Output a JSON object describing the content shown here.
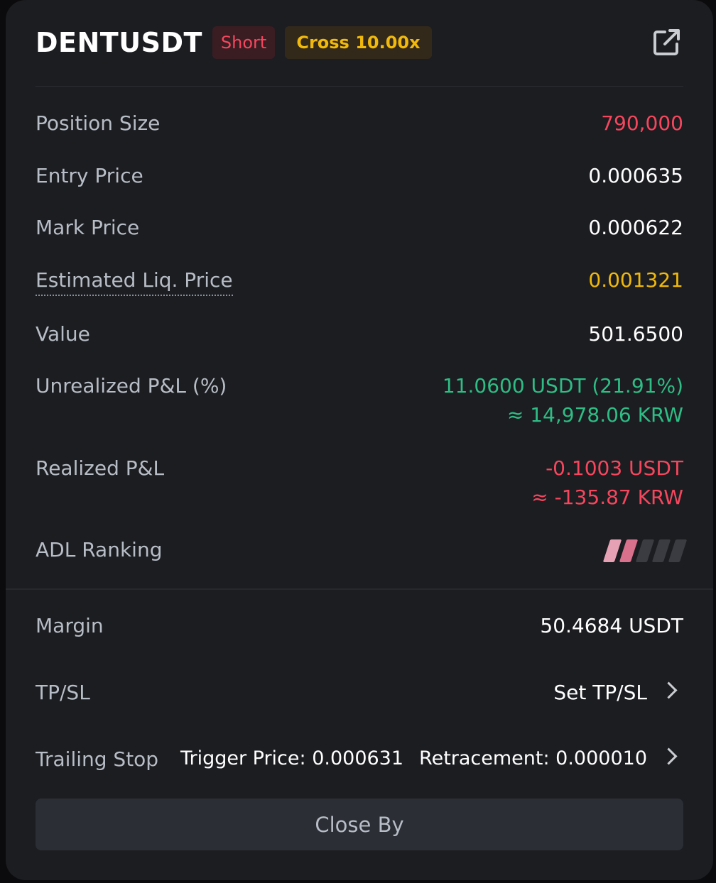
{
  "header": {
    "symbol": "DENTUSDT",
    "side_badge": "Short",
    "margin_badge": "Cross 10.00x",
    "share_icon": "external-link-icon"
  },
  "rows": {
    "position_size": {
      "label": "Position Size",
      "value": "790,000"
    },
    "entry_price": {
      "label": "Entry Price",
      "value": "0.000635"
    },
    "mark_price": {
      "label": "Mark Price",
      "value": "0.000622"
    },
    "liq_price": {
      "label": "Estimated Liq. Price",
      "value": "0.001321"
    },
    "value": {
      "label": "Value",
      "value": "501.6500"
    },
    "unrealized_pnl": {
      "label": "Unrealized P&L (%)",
      "value": "11.0600 USDT (21.91%)",
      "value_krw": "≈ 14,978.06 KRW"
    },
    "realized_pnl": {
      "label": "Realized P&L",
      "value": "-0.1003 USDT",
      "value_krw": "≈ -135.87 KRW"
    },
    "adl_ranking": {
      "label": "ADL Ranking",
      "level": 2,
      "max": 5
    },
    "margin": {
      "label": "Margin",
      "value": "50.4684 USDT"
    },
    "tpsl": {
      "label": "TP/SL",
      "value": "Set TP/SL"
    },
    "trailing_stop": {
      "label": "Trailing Stop",
      "trigger": "Trigger Price: 0.000631",
      "retracement": "Retracement: 0.000010"
    }
  },
  "actions": {
    "close_by": "Close By"
  },
  "colors": {
    "background": "#1c1d21",
    "red": "#f6465d",
    "green": "#2ebd85",
    "yellow": "#f0b90b",
    "adl_active_1": "#e6a2b4",
    "adl_active_2": "#d9708c",
    "adl_inactive": "#3a3c42"
  }
}
